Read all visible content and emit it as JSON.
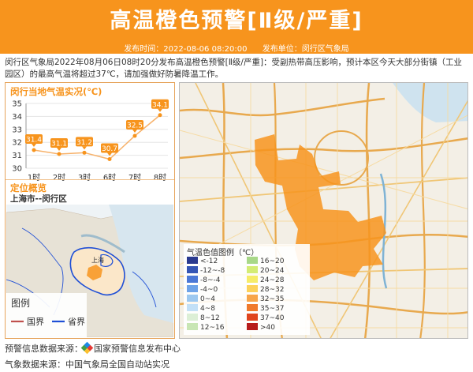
{
  "header": {
    "title": "高温橙色预警[Ⅱ级/严重]",
    "publish_time": "发布时间：2022-08-06 08:20:00",
    "publisher": "发布单位：闵行区气象局"
  },
  "description": "闵行区气象局2022年08月06日08时20分发布高温橙色预警[Ⅱ级/严重]：受副热带高压影响，预计本区今天大部分街镇（工业园区）的最高气温将超过37℃，请加强做好防暑降温工作。",
  "temp_section": {
    "title": "闵行当地气温实况(℃)"
  },
  "chart_data": {
    "type": "line",
    "categories": [
      "1时",
      "2时",
      "3时",
      "6时",
      "7时",
      "8时"
    ],
    "values": [
      31.4,
      31.1,
      31.2,
      30.7,
      32.5,
      34.1
    ],
    "ylim": [
      30,
      35
    ],
    "yticks": [
      "30",
      "31",
      "32",
      "33",
      "34",
      "35"
    ],
    "grid": true,
    "color": "#f7941d"
  },
  "location_section": {
    "title": "定位概览",
    "place": "上海市--闵行区",
    "city_label": "上海"
  },
  "inset_legend": {
    "title": "图例",
    "national": "国界",
    "provincial": "省界",
    "national_color": "#c0504d",
    "provincial_color": "#1f4fd6"
  },
  "temp_legend": {
    "title": "气温色值图例（℃）",
    "left": [
      {
        "label": "<-12",
        "color": "#2a3a8f"
      },
      {
        "label": "-12~-8",
        "color": "#3556b5"
      },
      {
        "label": "-8~-4",
        "color": "#4b78d6"
      },
      {
        "label": "-4~0",
        "color": "#6ea3e8"
      },
      {
        "label": "0~4",
        "color": "#9cc8f0"
      },
      {
        "label": "4~8",
        "color": "#c2e0f7"
      },
      {
        "label": "8~12",
        "color": "#dcefd6"
      },
      {
        "label": "12~16",
        "color": "#c8e6b4"
      }
    ],
    "right": [
      {
        "label": "16~20",
        "color": "#a8d888"
      },
      {
        "label": "20~24",
        "color": "#d4ec74"
      },
      {
        "label": "24~28",
        "color": "#f6ec68"
      },
      {
        "label": "28~32",
        "color": "#fcd25a"
      },
      {
        "label": "32~35",
        "color": "#f7a54a"
      },
      {
        "label": "35~37",
        "color": "#f07a2c"
      },
      {
        "label": "37~40",
        "color": "#e0451e"
      },
      {
        "label": ">40",
        "color": "#b71c1c"
      }
    ]
  },
  "footer": {
    "warning_source": "预警信息数据来源：",
    "warning_source_name": "国家预警信息发布中心",
    "weather_source": "气象数据来源：中国气象局全国自动站实况"
  }
}
